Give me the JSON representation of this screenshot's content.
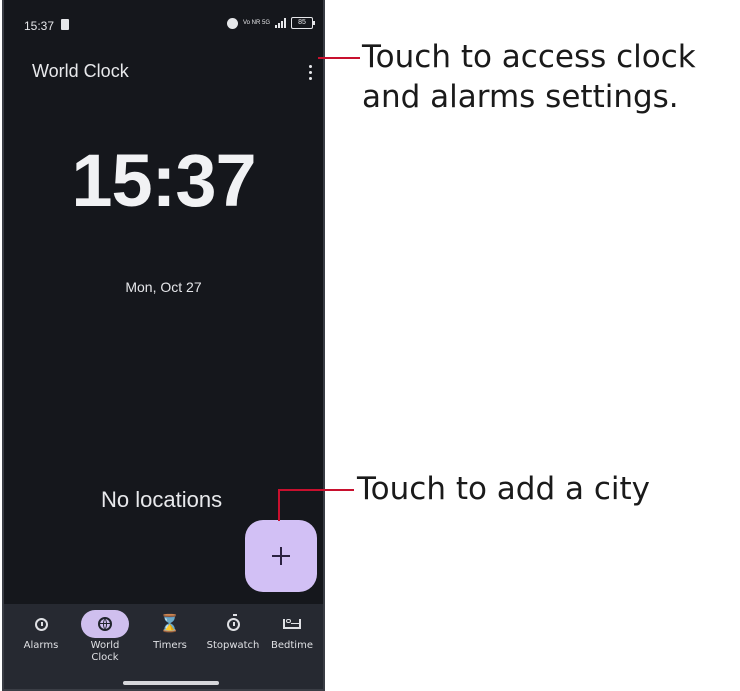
{
  "status_bar": {
    "time": "15:37",
    "network": "Vo NR 5G",
    "battery": "85"
  },
  "app": {
    "title": "World Clock",
    "current_time": "15:37",
    "date": "Mon, Oct 27",
    "empty_state": "No locations",
    "fab_icon": "plus-icon"
  },
  "bottom_nav": {
    "active": "World Clock",
    "items": [
      {
        "label": "Alarms",
        "icon": "alarm-icon"
      },
      {
        "label": "World Clock",
        "icon": "globe-icon"
      },
      {
        "label": "Timers",
        "icon": "hourglass-icon"
      },
      {
        "label": "Stopwatch",
        "icon": "stopwatch-icon"
      },
      {
        "label": "Bedtime",
        "icon": "bed-icon"
      }
    ]
  },
  "callouts": {
    "settings": "Touch to access clock and alarms settings.",
    "add_city": "Touch to add a city"
  },
  "colors": {
    "background": "#15171c",
    "fab": "#d2c0f5",
    "nav_background": "#262931",
    "callout_line": "#c8102e"
  }
}
